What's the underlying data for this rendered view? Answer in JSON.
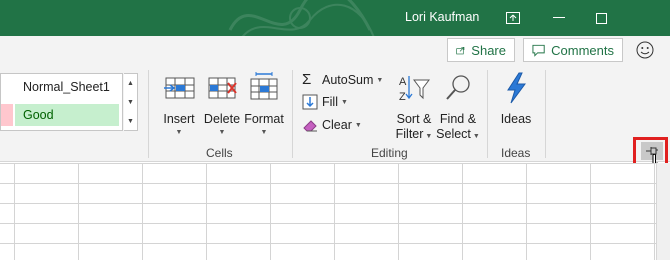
{
  "titlebar": {
    "user_name": "Lori Kaufman",
    "icons": {
      "ribbon_display": "ribbon-display-options-icon",
      "minimize": "minimize-icon",
      "maximize": "maximize-icon"
    }
  },
  "share_row": {
    "share_label": "Share",
    "comments_label": "Comments",
    "icons": {
      "share": "share-icon",
      "comments": "comment-icon",
      "feedback": "smiley-icon"
    }
  },
  "styles": {
    "normal_label": "Normal_Sheet1",
    "good_label": "Good"
  },
  "cells_group": {
    "label": "Cells",
    "insert_label": "Insert",
    "delete_label": "Delete",
    "format_label": "Format"
  },
  "editing_group": {
    "label": "Editing",
    "autosum_label": "AutoSum",
    "fill_label": "Fill",
    "clear_label": "Clear",
    "sort_label_line1": "Sort &",
    "sort_label_line2": "Filter",
    "find_label_line1": "Find &",
    "find_label_line2": "Select"
  },
  "ideas_group": {
    "label": "Ideas",
    "ideas_label": "Ideas"
  },
  "colors": {
    "title_bar": "#217346",
    "accent_green": "#217346",
    "good_fill": "#c6efce",
    "good_text": "#006100",
    "bad_fill": "#ffc7ce",
    "highlight_box": "#e0201f"
  }
}
